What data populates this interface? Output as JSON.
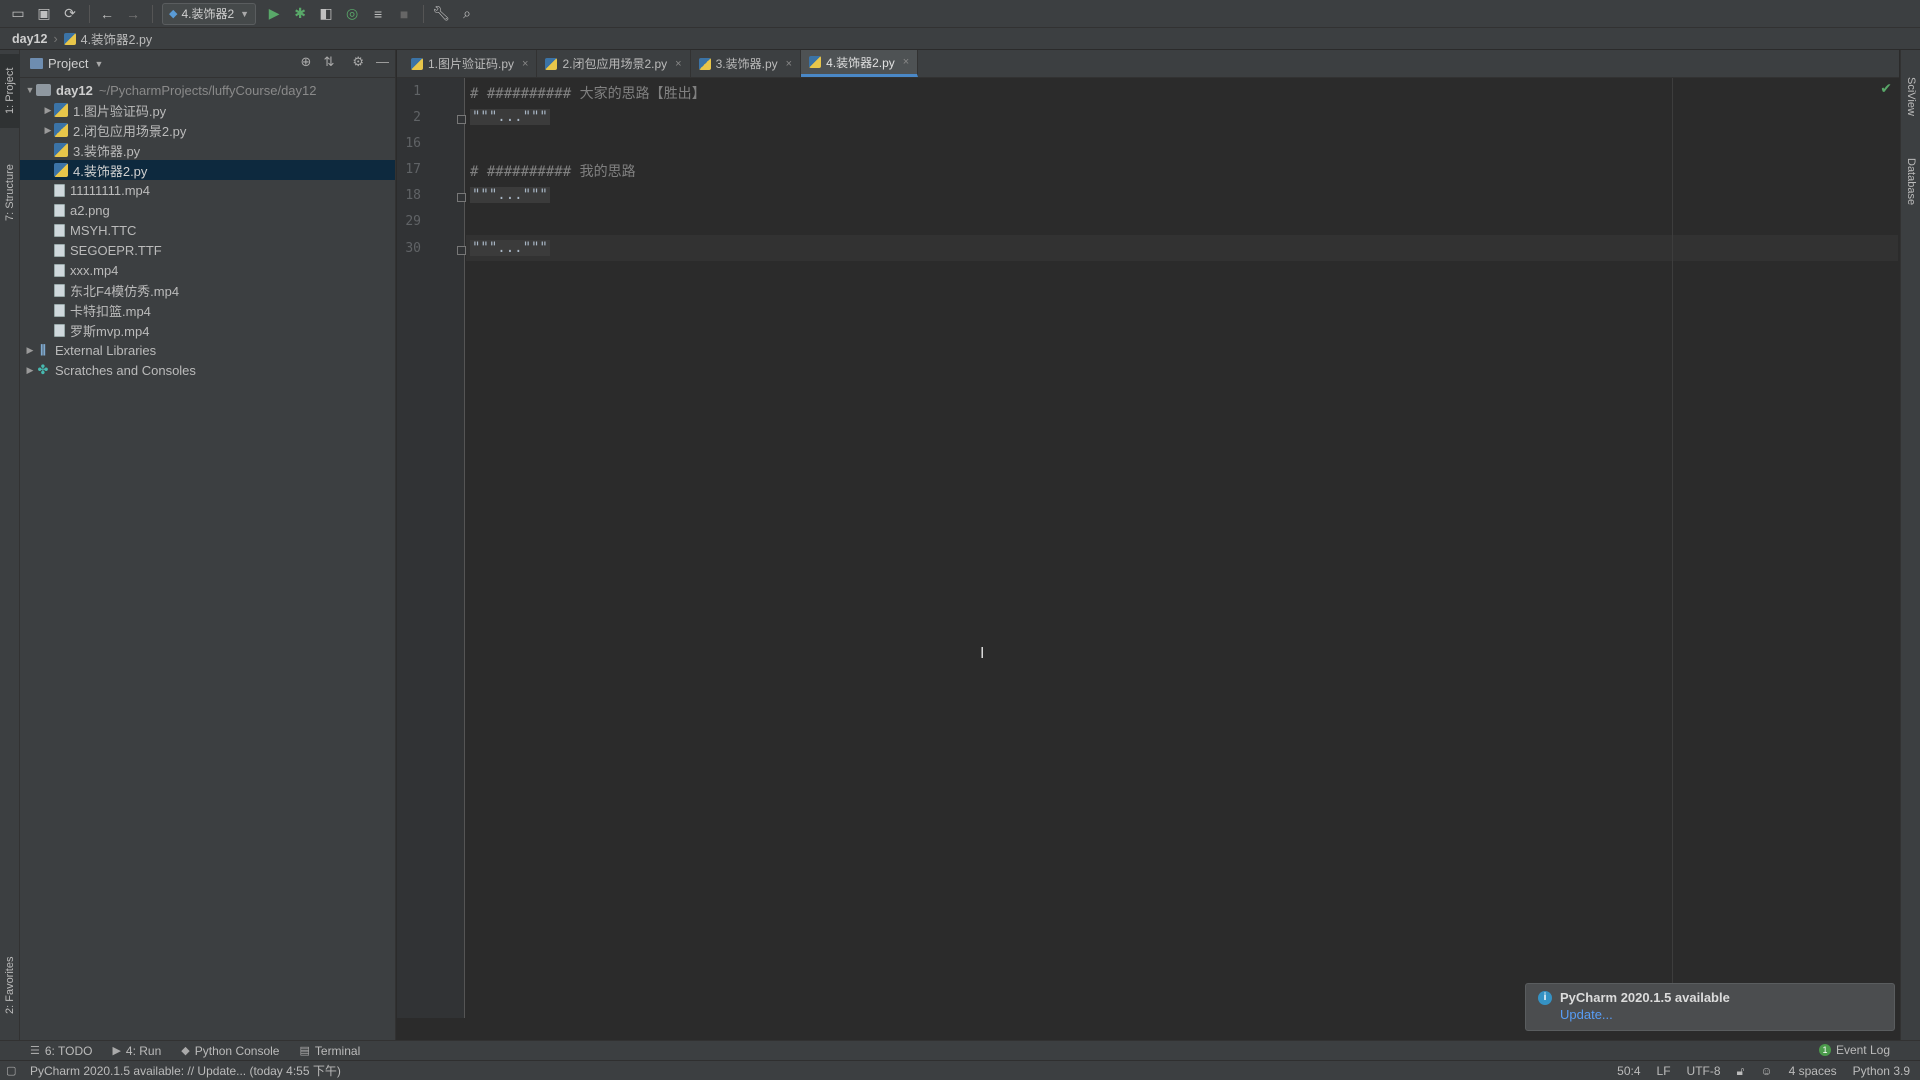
{
  "toolbar": {
    "run_config": "4.装饰器2",
    "icons": [
      "open-icon",
      "save-icon",
      "sync-icon",
      "back-icon",
      "forward-icon",
      "run-icon",
      "debug-icon",
      "coverage-icon",
      "profile-icon",
      "concurrency-icon",
      "stop-icon",
      "wrench-icon",
      "search-icon"
    ]
  },
  "breadcrumb": {
    "project": "day12",
    "file": "4.装饰器2.py"
  },
  "left_strip": {
    "project_tab": "1: Project",
    "structure_tab": "7: Structure",
    "favorites_tab": "2: Favorites"
  },
  "right_strip": {
    "sciview_tab": "SciView",
    "database_tab": "Database"
  },
  "project_panel": {
    "title": "Project",
    "root_name": "day12",
    "root_path": "~/PycharmProjects/luffyCourse/day12",
    "files": [
      {
        "name": "1.图片验证码.py",
        "type": "py",
        "expandable": true
      },
      {
        "name": "2.闭包应用场景2.py",
        "type": "py",
        "expandable": true
      },
      {
        "name": "3.装饰器.py",
        "type": "py",
        "expandable": false
      },
      {
        "name": "4.装饰器2.py",
        "type": "py",
        "expandable": false,
        "selected": true
      },
      {
        "name": "11111111.mp4",
        "type": "file"
      },
      {
        "name": "a2.png",
        "type": "file"
      },
      {
        "name": "MSYH.TTC",
        "type": "file"
      },
      {
        "name": "SEGOEPR.TTF",
        "type": "file"
      },
      {
        "name": "xxx.mp4",
        "type": "file"
      },
      {
        "name": "东北F4模仿秀.mp4",
        "type": "file"
      },
      {
        "name": "卡特扣篮.mp4",
        "type": "file"
      },
      {
        "name": "罗斯mvp.mp4",
        "type": "file"
      }
    ],
    "external_libraries": "External Libraries",
    "scratches": "Scratches and Consoles"
  },
  "tabs": [
    {
      "label": "1.图片验证码.py",
      "active": false
    },
    {
      "label": "2.闭包应用场景2.py",
      "active": false
    },
    {
      "label": "3.装饰器.py",
      "active": false
    },
    {
      "label": "4.装饰器2.py",
      "active": true
    }
  ],
  "editor": {
    "lines": [
      {
        "number": "1",
        "text": "# ########## 大家的思路【胜出】",
        "fold": false
      },
      {
        "number": "2",
        "text": "\"\"\"...\"\"\"",
        "fold": true
      },
      {
        "number": "16",
        "text": "",
        "fold": false
      },
      {
        "number": "17",
        "text": "# ########## 我的思路",
        "fold": false
      },
      {
        "number": "18",
        "text": "\"\"\"...\"\"\"",
        "fold": true
      },
      {
        "number": "29",
        "text": "",
        "fold": false
      },
      {
        "number": "30",
        "text": "\"\"\"...\"\"\"",
        "fold": true
      }
    ]
  },
  "notification": {
    "title": "PyCharm 2020.1.5 available",
    "link": "Update..."
  },
  "tool_windows": {
    "todo": "6: TODO",
    "run": "4: Run",
    "python_console": "Python Console",
    "terminal": "Terminal",
    "event_log": "Event Log",
    "event_log_count": "1"
  },
  "status_bar": {
    "message": "PyCharm 2020.1.5 available: // Update... (today 4:55 下午)",
    "position": "50:4",
    "line_sep": "LF",
    "encoding": "UTF-8",
    "indent": "4 spaces",
    "interpreter": "Python 3.9"
  }
}
